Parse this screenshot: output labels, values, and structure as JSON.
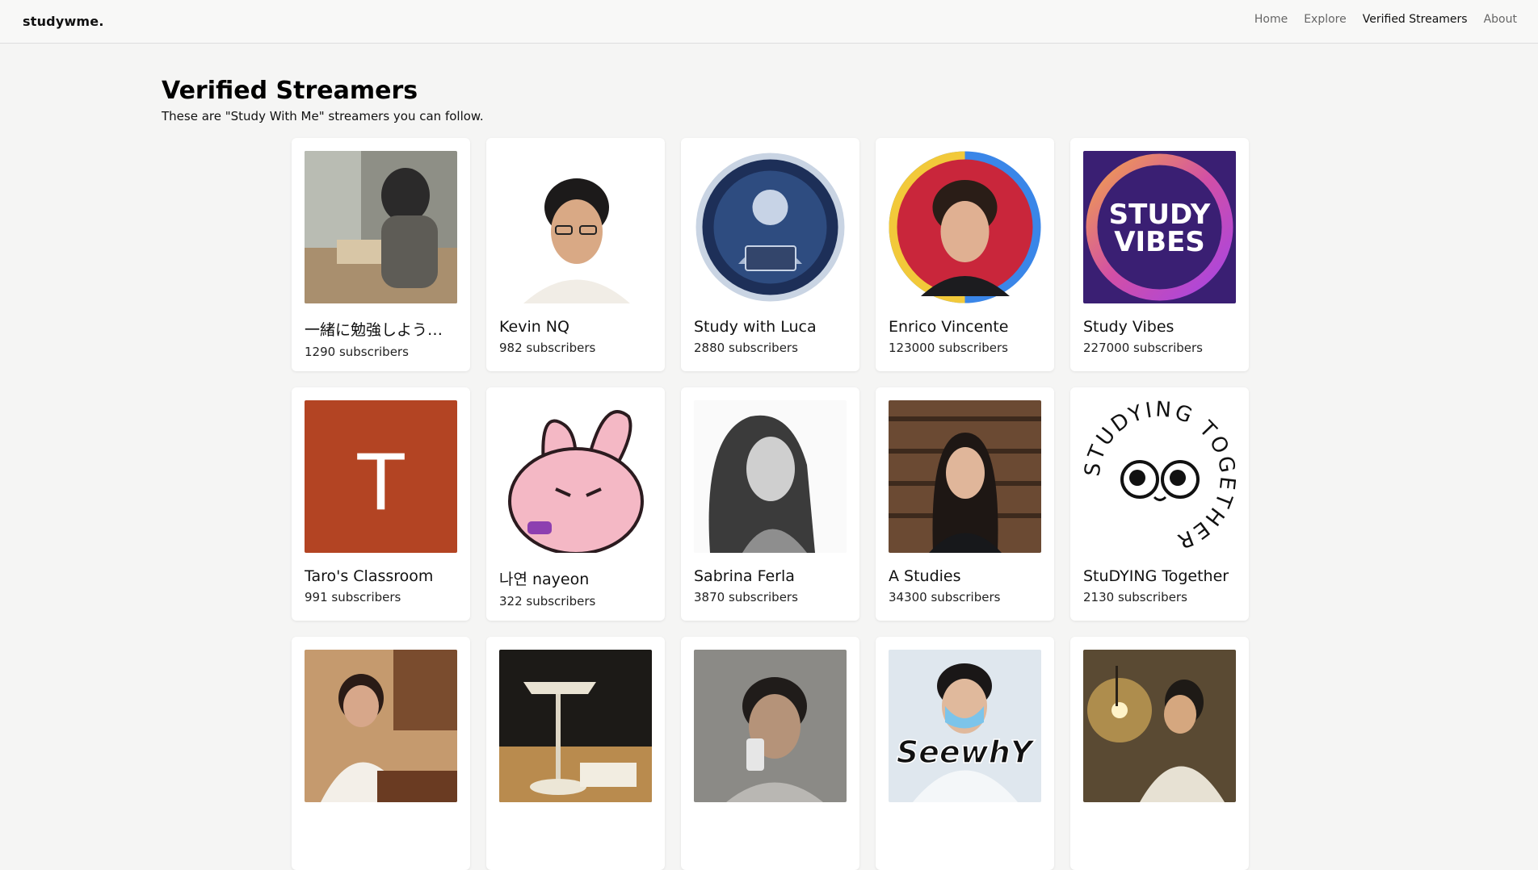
{
  "nav": {
    "brand": "studywme.",
    "links": [
      {
        "label": "Home"
      },
      {
        "label": "Explore"
      },
      {
        "label": "Verified Streamers"
      },
      {
        "label": "About"
      }
    ]
  },
  "header": {
    "title": "Verified Streamers",
    "subtitle": "These are \"Study With Me\" streamers you can follow."
  },
  "streamers": [
    {
      "name": "一緒に勉強しよう📖📚",
      "subscribers": "1290 subscribers"
    },
    {
      "name": "Kevin NQ",
      "subscribers": "982 subscribers"
    },
    {
      "name": "Study with Luca",
      "subscribers": "2880 subscribers"
    },
    {
      "name": "Enrico Vincente",
      "subscribers": "123000 subscribers"
    },
    {
      "name": "Study Vibes",
      "subscribers": "227000 subscribers",
      "logo_text": [
        "STUDY",
        "VIBES"
      ]
    },
    {
      "name": "Taro's Classroom",
      "subscribers": "991 subscribers",
      "initial": "T"
    },
    {
      "name": "나연 nayeon",
      "subscribers": "322 subscribers"
    },
    {
      "name": "Sabrina Ferla",
      "subscribers": "3870 subscribers"
    },
    {
      "name": "A Studies",
      "subscribers": "34300 subscribers"
    },
    {
      "name": "StuDYING Together",
      "subscribers": "2130 subscribers",
      "logo_text": "STUDYING TOGETHER"
    },
    {
      "name": "",
      "subscribers": ""
    },
    {
      "name": "",
      "subscribers": ""
    },
    {
      "name": "",
      "subscribers": ""
    },
    {
      "name": "",
      "subscribers": "",
      "logo_text": "SeewhY"
    },
    {
      "name": "",
      "subscribers": ""
    }
  ],
  "colors": {
    "background": "#f5f5f4",
    "taro_tile": "#b34423",
    "study_vibes_bg": "#3a1f73"
  }
}
